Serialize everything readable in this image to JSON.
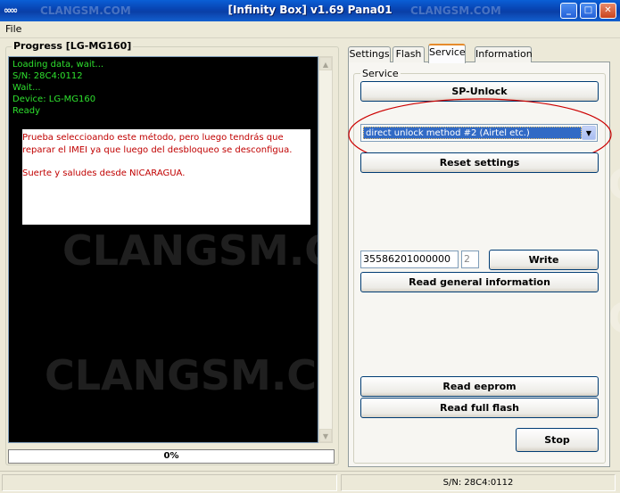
{
  "window": {
    "title": "[Infinity Box] v1.69 Pana01",
    "app_icon": "infinity-icon",
    "controls": [
      "minimize-icon",
      "maximize-icon",
      "close-icon"
    ]
  },
  "watermark": "CLANGSM.COM",
  "menu": {
    "file": "File"
  },
  "progress": {
    "group_title": "Progress [LG-MG160]",
    "log_lines": [
      "Loading data, wait...",
      "S/N: 28C4:0112",
      "Wait...",
      "Device: LG-MG160",
      "Ready"
    ],
    "note_line1": "Prueba seleccioando este método, pero luego tendrás que reparar el IMEI ya que luego del desbloqueo se desconfigua.",
    "note_line2": "Suerte y saludes desde NICARAGUA.",
    "percent": "0%",
    "value": 0
  },
  "tabs": [
    "Settings",
    "Flash",
    "Service",
    "Information"
  ],
  "active_tab": "Service",
  "service": {
    "group_title": "Service",
    "sp_unlock": "SP-Unlock",
    "method_selected": "direct unlock method #2 (Airtel etc.)",
    "reset_settings": "Reset settings",
    "imei_value": "35586201000000",
    "imei_check": "2",
    "write": "Write",
    "read_general_info": "Read general information",
    "read_eeprom": "Read eeprom",
    "read_full_flash": "Read full flash",
    "stop": "Stop"
  },
  "status": {
    "serial": "S/N: 28C4:0112"
  },
  "colors": {
    "log_text": "#2ee02e",
    "note_text": "#c00000",
    "annotation": "#cc0000",
    "selection": "#316ac5"
  }
}
